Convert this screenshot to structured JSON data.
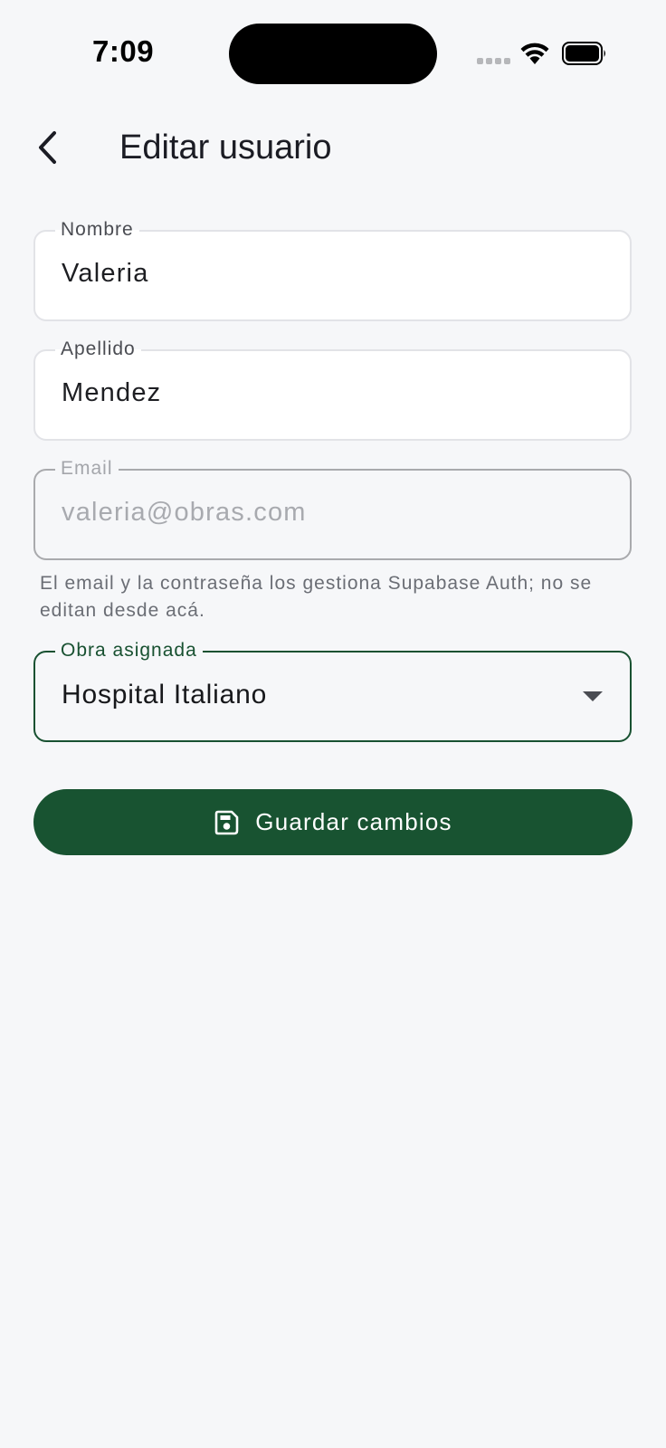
{
  "status_bar": {
    "time": "7:09"
  },
  "header": {
    "title": "Editar usuario",
    "back_icon": "chevron-left-icon"
  },
  "form": {
    "nombre": {
      "label": "Nombre",
      "value": "Valeria"
    },
    "apellido": {
      "label": "Apellido",
      "value": "Mendez"
    },
    "email": {
      "label": "Email",
      "value": "valeria@obras.com"
    },
    "helper": "El email y la contraseña los gestiona Supabase Auth; no se editan desde acá.",
    "obra": {
      "label": "Obra asignada",
      "selected": "Hospital Italiano"
    }
  },
  "actions": {
    "save_label": "Guardar cambios",
    "save_icon": "save-icon"
  },
  "colors": {
    "background": "#f6f7f9",
    "accent": "#185331",
    "text": "#1b1c24",
    "helper_text": "#6b6e75"
  }
}
